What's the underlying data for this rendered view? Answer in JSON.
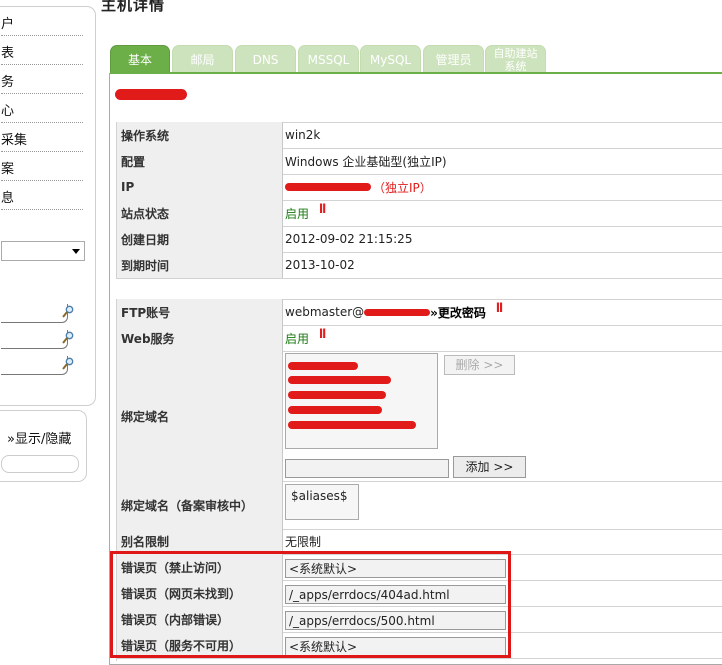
{
  "sidebar": {
    "items": [
      "户",
      "表",
      "务",
      "心",
      "采集",
      "案",
      "息"
    ],
    "toggle_label": "»显示/隐藏"
  },
  "page_title": "主机详情",
  "tabs": [
    {
      "label": "基本",
      "active": true
    },
    {
      "label": "邮局",
      "active": false
    },
    {
      "label": "DNS",
      "active": false
    },
    {
      "label": "MSSQL",
      "active": false
    },
    {
      "label": "MySQL",
      "active": false
    },
    {
      "label": "管理员",
      "active": false
    },
    {
      "label": "自助建站\n系统",
      "active": false
    }
  ],
  "section1": {
    "os_label": "操作系统",
    "os_value": "win2k",
    "config_label": "配置",
    "config_value": "Windows 企业基础型(独立IP)",
    "ip_label": "IP",
    "ip_suffix": "（独立IP）",
    "status_label": "站点状态",
    "status_value": "启用",
    "created_label": "创建日期",
    "created_value": "2012-09-02 21:15:25",
    "expire_label": "到期时间",
    "expire_value": "2013-10-02"
  },
  "section2": {
    "ftp_label": "FTP账号",
    "ftp_user_prefix": "webmaster@",
    "change_pwd_link": "»更改密码",
    "web_label": "Web服务",
    "web_value": "启用",
    "domain_label": "绑定域名",
    "delete_button": "删除 >>",
    "add_button": "添加 >>",
    "domain_pending_label": "绑定域名（备案审核中）",
    "aliases_value": "$aliases$",
    "alias_limit_label": "别名限制",
    "alias_limit_value": "无限制",
    "err403_label": "错误页（禁止访问）",
    "err403_value": "<系统默认>",
    "err404_label": "错误页（网页未找到）",
    "err404_value": "/_apps/errdocs/404ad.html",
    "err500_label": "错误页（内部错误）",
    "err500_value": "/_apps/errdocs/500.html",
    "err503_label": "错误页（服务不可用）",
    "err503_value": "<系统默认>"
  },
  "icons": {
    "search": "magnifier-icon",
    "pause": "pause-icon",
    "dropdown": "chevron-down-icon"
  },
  "colors": {
    "tab_active": "#6cae47",
    "tab_inactive": "#cde3bd",
    "status_green": "#1b7a12",
    "alert_red": "#e01717"
  }
}
